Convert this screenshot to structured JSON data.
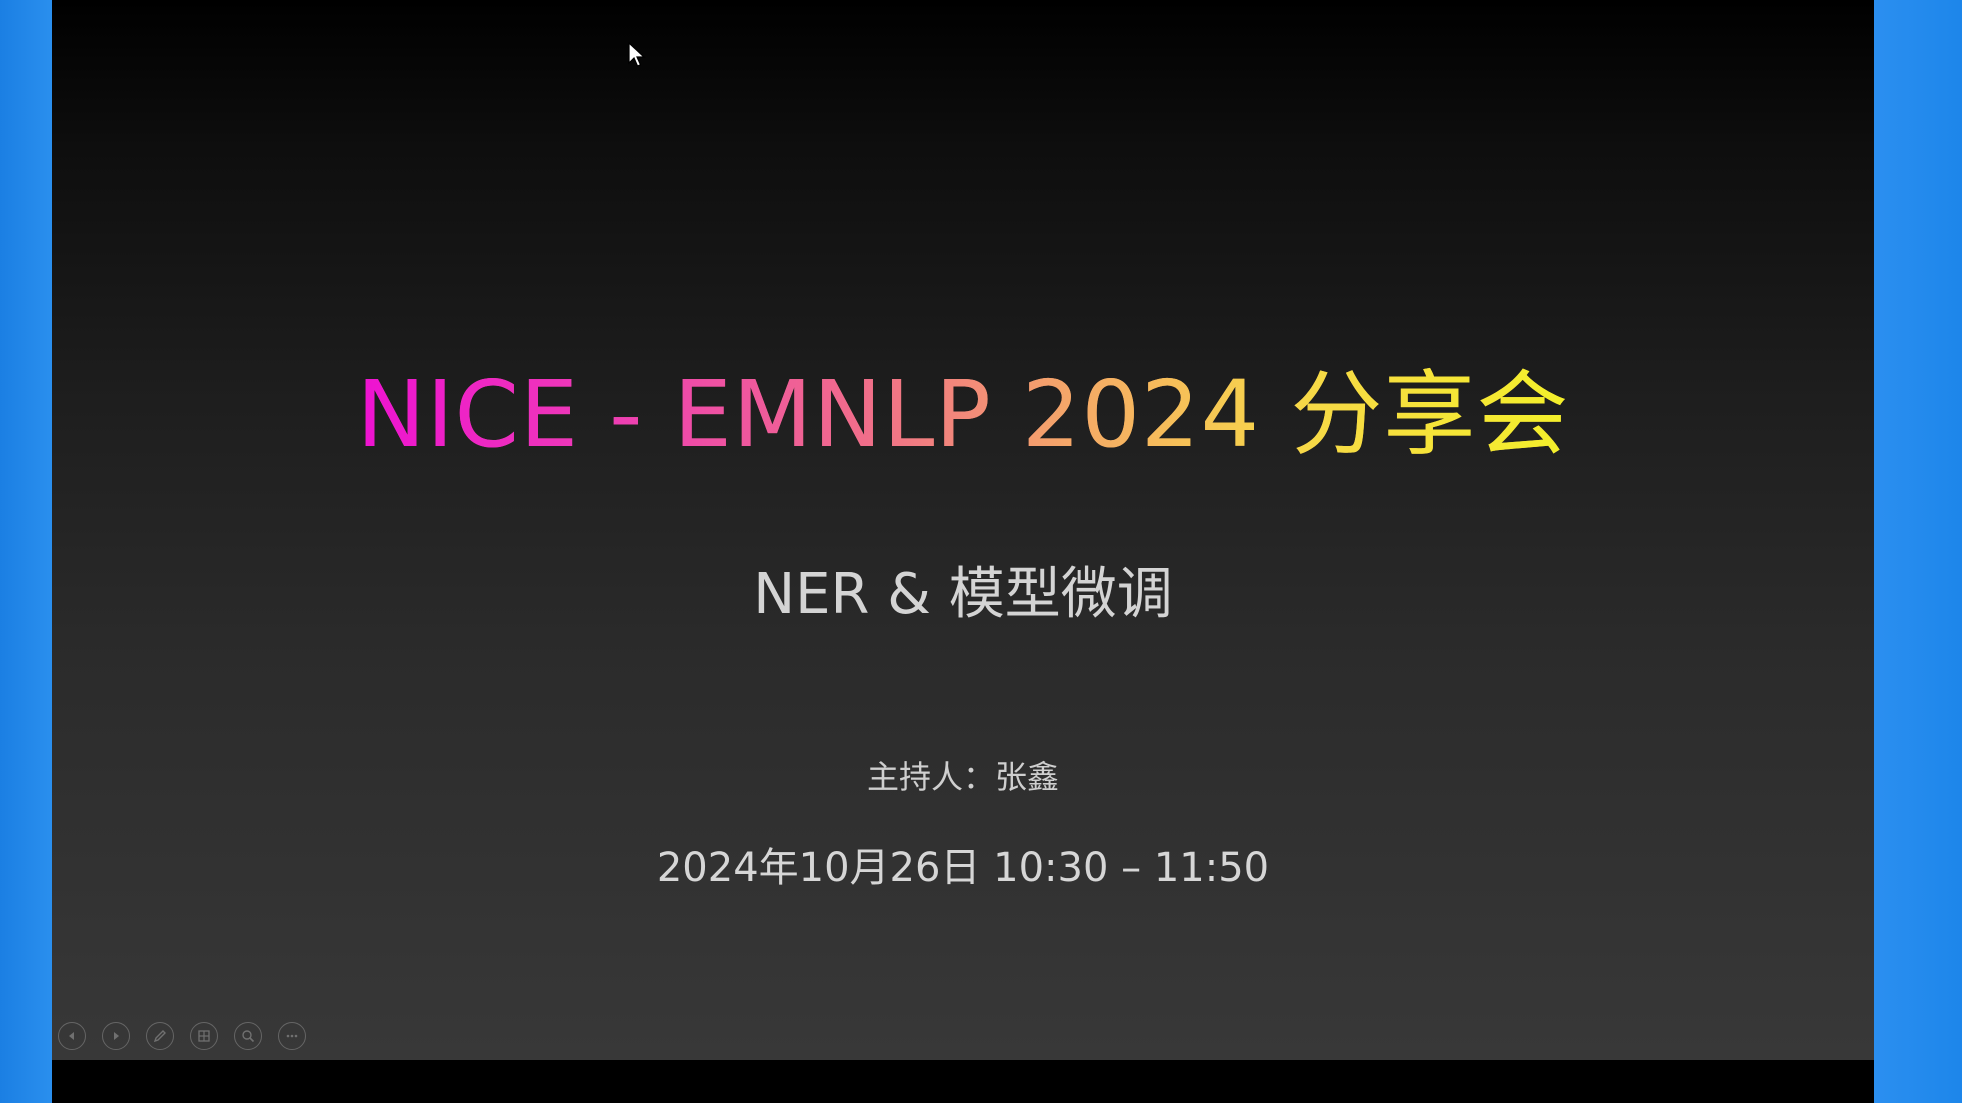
{
  "slide": {
    "title": "NICE - EMNLP 2024 分享会",
    "subtitle": "NER & 模型微调",
    "host_line": "主持人：张鑫",
    "datetime": "2024年10月26日 10:30 – 11:50"
  },
  "controls": {
    "items": [
      {
        "name": "previous-slide",
        "icon": "arrow-left-icon"
      },
      {
        "name": "next-slide",
        "icon": "arrow-right-icon"
      },
      {
        "name": "pen-tool",
        "icon": "pen-icon"
      },
      {
        "name": "see-all-slides",
        "icon": "grid-icon"
      },
      {
        "name": "zoom",
        "icon": "magnifier-icon"
      },
      {
        "name": "more-options",
        "icon": "ellipsis-icon"
      }
    ]
  },
  "colors": {
    "side_blue": "#2b8ff0",
    "title_gradient_start": "#ee12d2",
    "title_gradient_end": "#f4f02a",
    "text_light": "#d4d4d4"
  }
}
